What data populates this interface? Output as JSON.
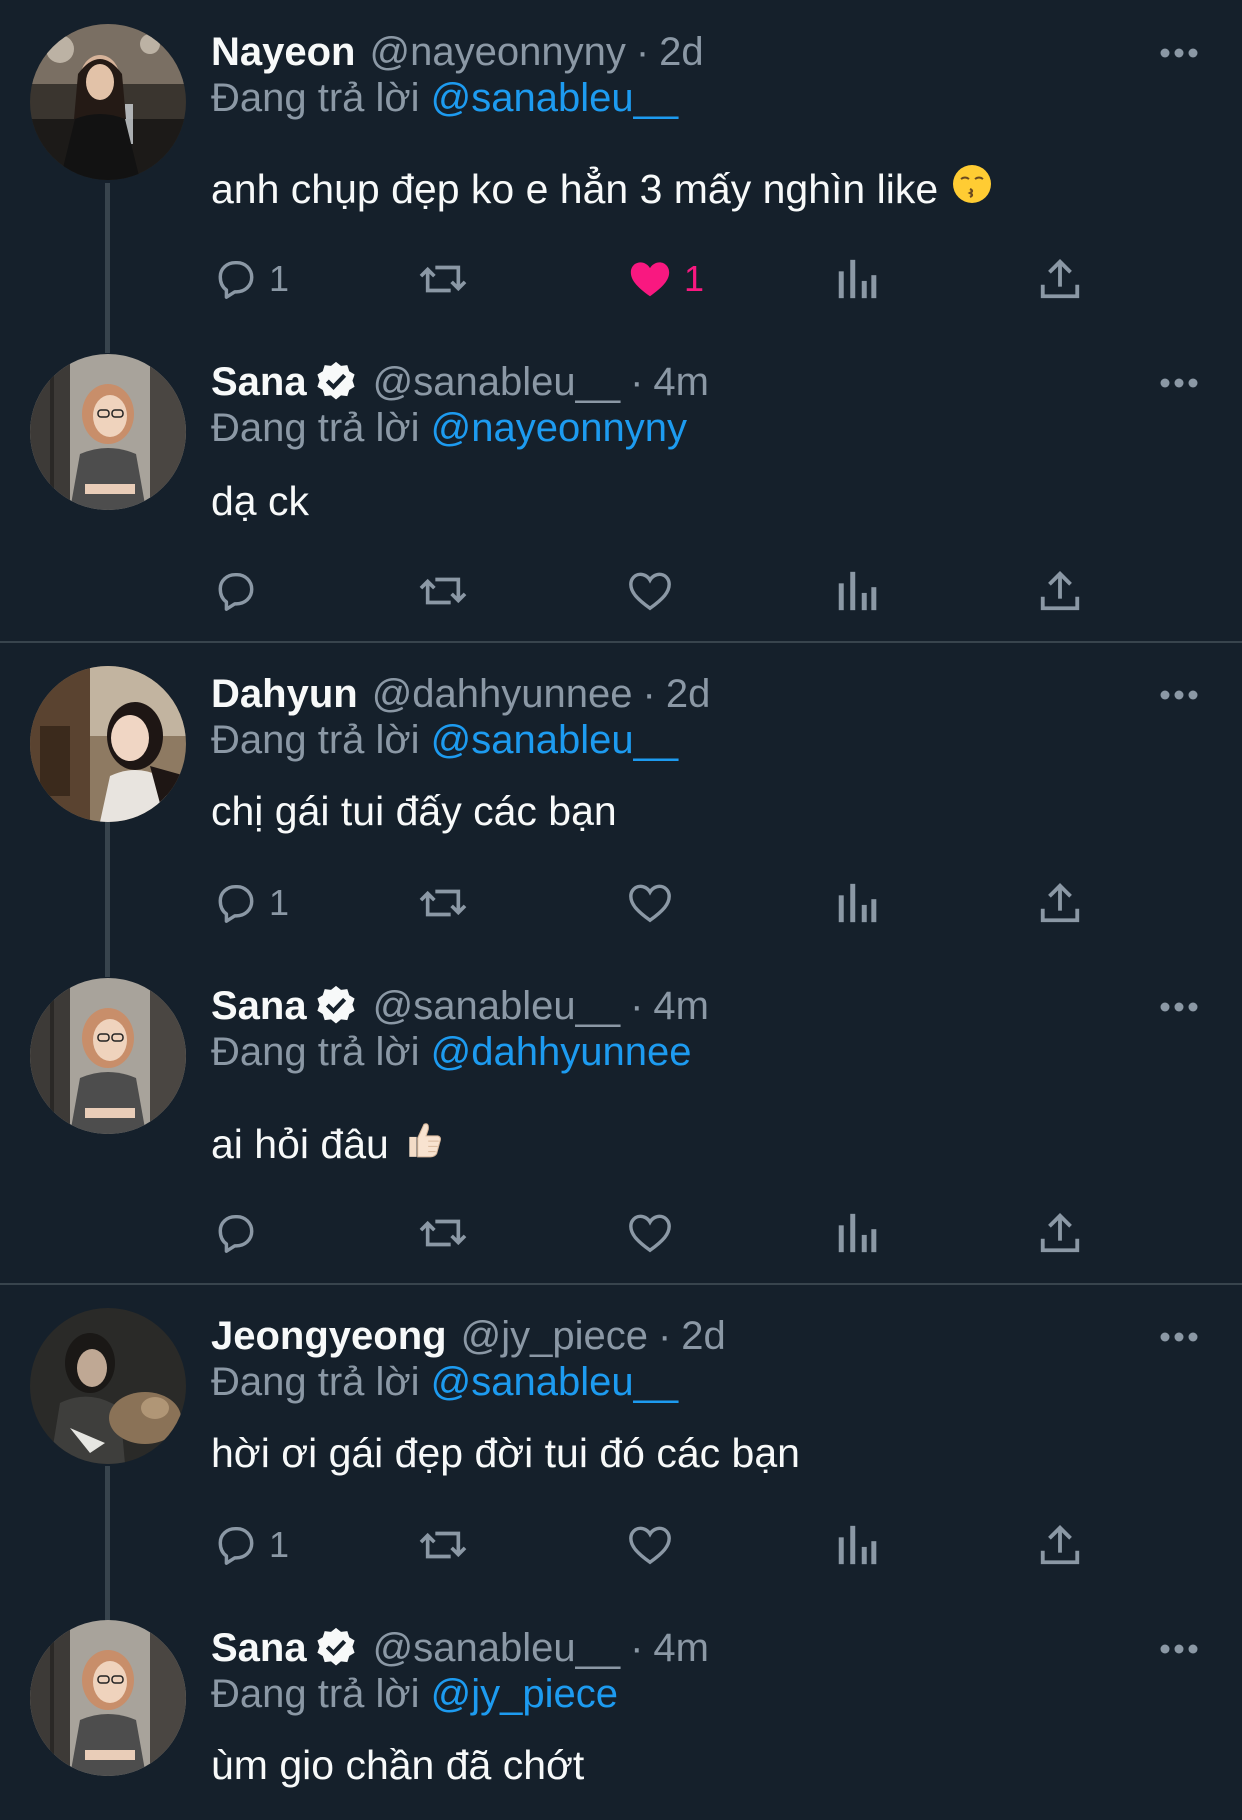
{
  "reply_prefix": "Đang trả lời",
  "colors": {
    "background": "#15202b",
    "secondary_text": "#8b98a5",
    "mention": "#1d9bf0",
    "like": "#f91880",
    "divider": "#38444d"
  },
  "tweets": [
    {
      "name": "Nayeon",
      "handle": "@nayeonnyny",
      "dot": "·",
      "time": "2d",
      "reply_to": "@sanableu__",
      "text": "anh chụp đẹp ko e hẳn 3 mấy nghìn like",
      "emoji": "😙",
      "reply_count": "1",
      "like_count": "1",
      "liked": true
    },
    {
      "name": "Sana",
      "verified": true,
      "handle": "@sanableu__",
      "dot": "·",
      "time": "4m",
      "reply_to": "@nayeonnyny",
      "text": "dạ ck"
    },
    {
      "name": "Dahyun",
      "handle": "@dahhyunnee",
      "dot": "·",
      "time": "2d",
      "reply_to": "@sanableu__",
      "text": "chị gái tui đấy các bạn",
      "reply_count": "1"
    },
    {
      "name": "Sana",
      "verified": true,
      "handle": "@sanableu__",
      "dot": "·",
      "time": "4m",
      "reply_to": "@dahhyunnee",
      "text": "ai hỏi đâu",
      "emoji": "👍🏻"
    },
    {
      "name": "Jeongyeong",
      "handle": "@jy_piece",
      "dot": "·",
      "time": "2d",
      "reply_to": "@sanableu__",
      "text": "hời ơi gái đẹp đời tui đó các bạn",
      "reply_count": "1"
    },
    {
      "name": "Sana",
      "verified": true,
      "handle": "@sanableu__",
      "dot": "·",
      "time": "4m",
      "reply_to": "@jy_piece",
      "text": "ùm gio chần đã chớt"
    }
  ],
  "icons": {
    "reply": "reply-bubble-icon",
    "retweet": "retweet-icon",
    "like": "heart-icon",
    "views": "views-chart-icon",
    "share": "share-upload-icon",
    "more": "more-dots-icon",
    "verified": "verified-badge-icon"
  }
}
